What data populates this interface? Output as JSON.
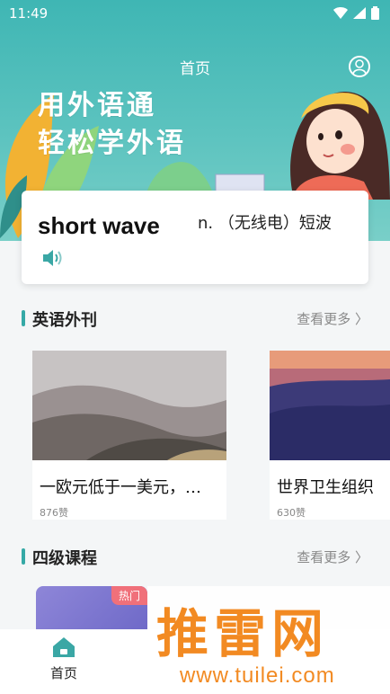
{
  "status_bar": {
    "time": "11:49"
  },
  "header": {
    "title": "首页"
  },
  "banner": {
    "line1": "用外语通",
    "line2": "轻松学外语"
  },
  "word_card": {
    "word": "short wave",
    "meaning": "n. （无线电）短波"
  },
  "sections": {
    "journal": {
      "title": "英语外刊",
      "more": "查看更多 〉"
    },
    "cet4": {
      "title": "四级课程",
      "more": "查看更多 〉"
    }
  },
  "articles": [
    {
      "title": "一欧元低于一美元，…",
      "likes": "876赞"
    },
    {
      "title": "世界卫生组织",
      "likes": "630赞"
    }
  ],
  "course": {
    "badge": "热门"
  },
  "bottom_nav": {
    "home_label": "首页"
  },
  "watermark": {
    "brand": "推雷网",
    "url": "www.tuilei.com"
  },
  "colors": {
    "accent": "#35a9a6",
    "hero": "#4dbdb9",
    "watermark": "#f28a22"
  }
}
